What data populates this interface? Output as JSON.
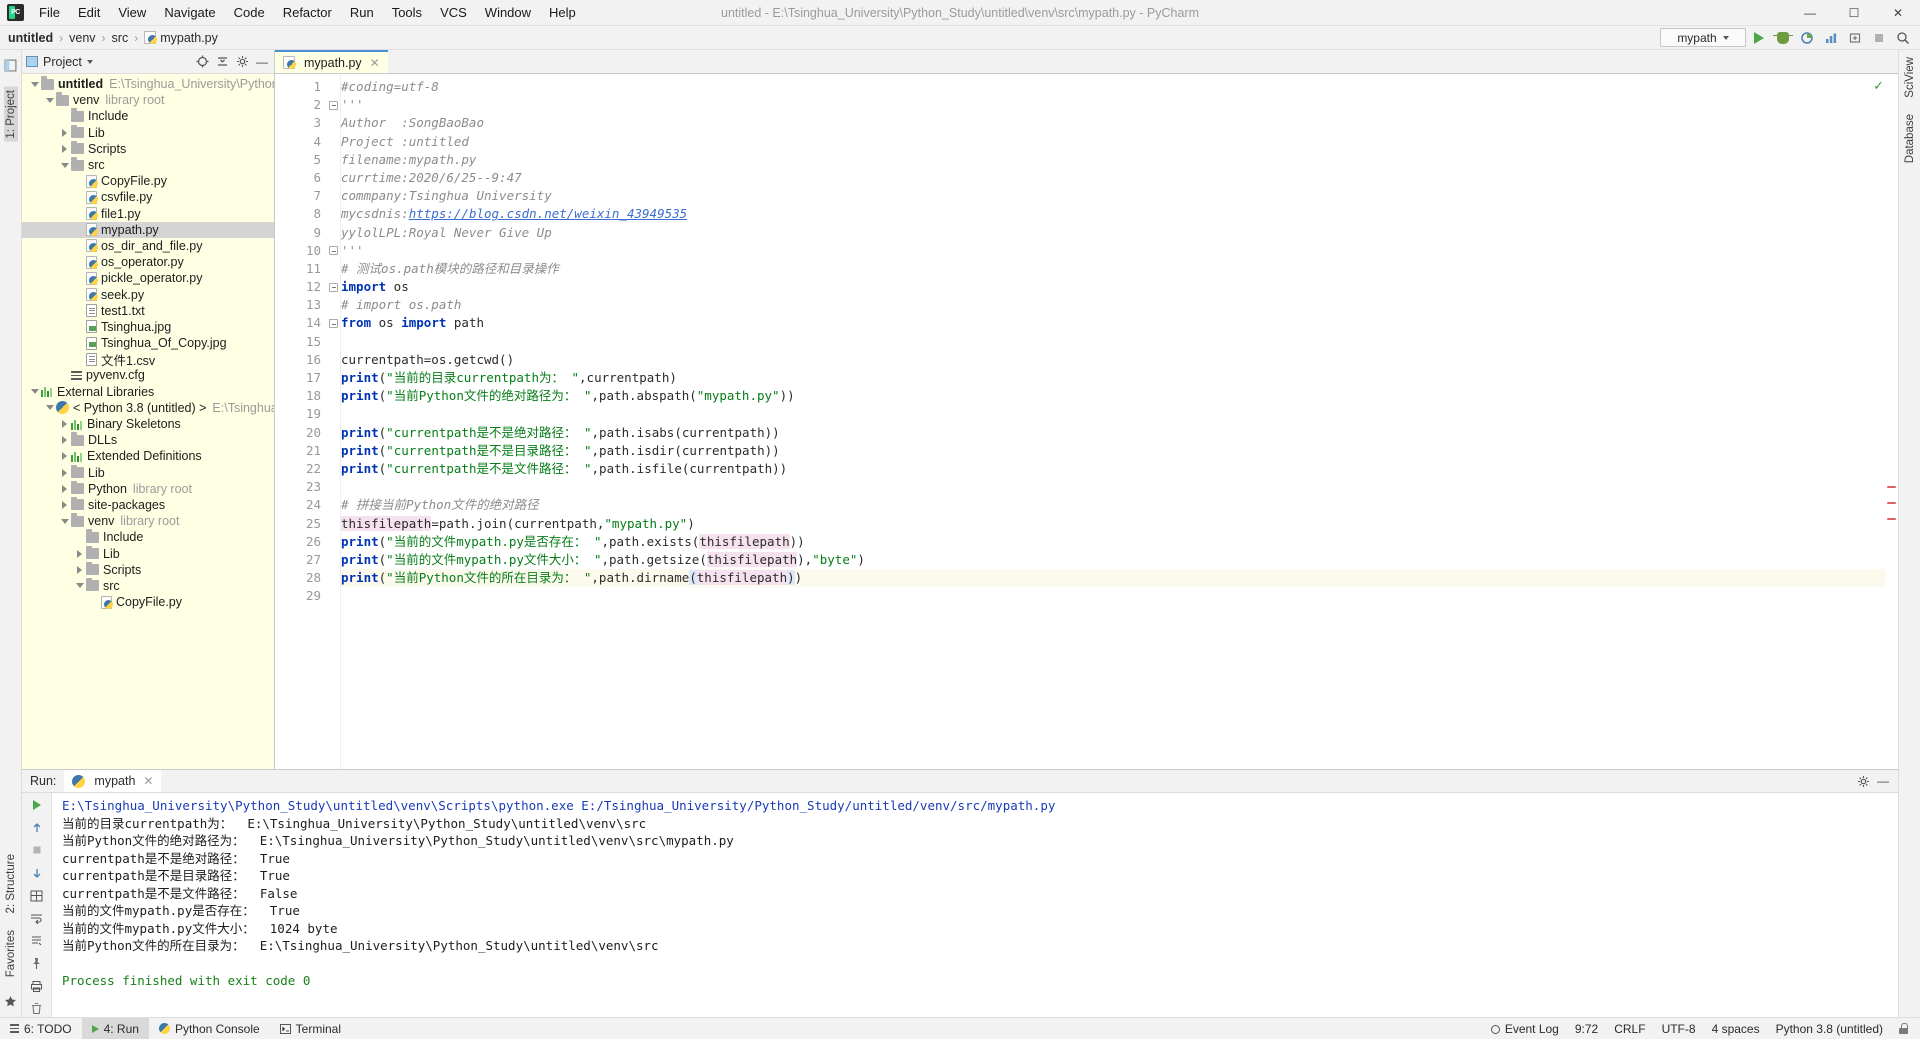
{
  "titlebar": {
    "app_badge": "PC",
    "title": "untitled - E:\\Tsinghua_University\\Python_Study\\untitled\\venv\\src\\mypath.py - PyCharm",
    "menu": [
      "File",
      "Edit",
      "View",
      "Navigate",
      "Code",
      "Refactor",
      "Run",
      "Tools",
      "VCS",
      "Window",
      "Help"
    ],
    "window_controls": {
      "minimize": "—",
      "maximize": "☐",
      "close": "✕"
    }
  },
  "navbar": {
    "crumbs": [
      "untitled",
      "venv",
      "src",
      "mypath.py"
    ],
    "separator": "›",
    "run_config": "mypath",
    "buttons": [
      "run-button",
      "debug-button",
      "coverage-button",
      "profile-button",
      "attach-button",
      "stop-button",
      "search-button"
    ]
  },
  "left_rail": {
    "top": [
      "1: Project"
    ],
    "bottom": [
      "2: Structure",
      "Favorites"
    ]
  },
  "right_rail": {
    "top": [
      "SciView",
      "Database"
    ]
  },
  "project_panel": {
    "title": "Project",
    "tree": [
      {
        "indent": 0,
        "arrow": "down",
        "icon": "folder",
        "name": "untitled",
        "bold": true,
        "sub": "E:\\Tsinghua_University\\Python_Study\\u"
      },
      {
        "indent": 1,
        "arrow": "down",
        "icon": "folder",
        "name": "venv",
        "sub": "library root"
      },
      {
        "indent": 2,
        "arrow": "none",
        "icon": "folder",
        "name": "Include",
        "sub": ""
      },
      {
        "indent": 2,
        "arrow": "right",
        "icon": "folder",
        "name": "Lib",
        "sub": ""
      },
      {
        "indent": 2,
        "arrow": "right",
        "icon": "folder",
        "name": "Scripts",
        "sub": ""
      },
      {
        "indent": 2,
        "arrow": "down",
        "icon": "folder",
        "name": "src",
        "sub": ""
      },
      {
        "indent": 3,
        "arrow": "none",
        "icon": "py",
        "name": "CopyFile.py",
        "sub": ""
      },
      {
        "indent": 3,
        "arrow": "none",
        "icon": "py",
        "name": "csvfile.py",
        "sub": ""
      },
      {
        "indent": 3,
        "arrow": "none",
        "icon": "py",
        "name": "file1.py",
        "sub": ""
      },
      {
        "indent": 3,
        "arrow": "none",
        "icon": "py",
        "name": "mypath.py",
        "sub": "",
        "selected": true
      },
      {
        "indent": 3,
        "arrow": "none",
        "icon": "py",
        "name": "os_dir_and_file.py",
        "sub": ""
      },
      {
        "indent": 3,
        "arrow": "none",
        "icon": "py",
        "name": "os_operator.py",
        "sub": ""
      },
      {
        "indent": 3,
        "arrow": "none",
        "icon": "py",
        "name": "pickle_operator.py",
        "sub": ""
      },
      {
        "indent": 3,
        "arrow": "none",
        "icon": "py",
        "name": "seek.py",
        "sub": ""
      },
      {
        "indent": 3,
        "arrow": "none",
        "icon": "txt",
        "name": "test1.txt",
        "sub": ""
      },
      {
        "indent": 3,
        "arrow": "none",
        "icon": "img",
        "name": "Tsinghua.jpg",
        "sub": ""
      },
      {
        "indent": 3,
        "arrow": "none",
        "icon": "img",
        "name": "Tsinghua_Of_Copy.jpg",
        "sub": ""
      },
      {
        "indent": 3,
        "arrow": "none",
        "icon": "txt",
        "name": "文件1.csv",
        "sub": ""
      },
      {
        "indent": 2,
        "arrow": "none",
        "icon": "cfg",
        "name": "pyvenv.cfg",
        "sub": ""
      },
      {
        "indent": 0,
        "arrow": "down",
        "icon": "lib",
        "name": "External Libraries",
        "sub": ""
      },
      {
        "indent": 1,
        "arrow": "down",
        "icon": "pyint",
        "name": "< Python 3.8 (untitled) >",
        "sub": "E:\\Tsinghua_Univers"
      },
      {
        "indent": 2,
        "arrow": "right",
        "icon": "lib",
        "name": "Binary Skeletons",
        "sub": ""
      },
      {
        "indent": 2,
        "arrow": "right",
        "icon": "folder",
        "name": "DLLs",
        "sub": ""
      },
      {
        "indent": 2,
        "arrow": "right",
        "icon": "lib",
        "name": "Extended Definitions",
        "sub": ""
      },
      {
        "indent": 2,
        "arrow": "right",
        "icon": "folder",
        "name": "Lib",
        "sub": ""
      },
      {
        "indent": 2,
        "arrow": "right",
        "icon": "folder",
        "name": "Python",
        "sub": "library root"
      },
      {
        "indent": 2,
        "arrow": "right",
        "icon": "folder",
        "name": "site-packages",
        "sub": ""
      },
      {
        "indent": 2,
        "arrow": "down",
        "icon": "folder",
        "name": "venv",
        "sub": "library root"
      },
      {
        "indent": 3,
        "arrow": "none",
        "icon": "folder",
        "name": "Include",
        "sub": ""
      },
      {
        "indent": 3,
        "arrow": "right",
        "icon": "folder",
        "name": "Lib",
        "sub": ""
      },
      {
        "indent": 3,
        "arrow": "right",
        "icon": "folder",
        "name": "Scripts",
        "sub": ""
      },
      {
        "indent": 3,
        "arrow": "down",
        "icon": "folder",
        "name": "src",
        "sub": ""
      },
      {
        "indent": 4,
        "arrow": "none",
        "icon": "py",
        "name": "CopyFile.py",
        "sub": ""
      }
    ]
  },
  "editor": {
    "tab": {
      "label": "mypath.py",
      "close": "✕"
    },
    "line_numbers": [
      1,
      2,
      3,
      4,
      5,
      6,
      7,
      8,
      9,
      10,
      11,
      12,
      13,
      14,
      15,
      16,
      17,
      18,
      19,
      20,
      21,
      22,
      23,
      24,
      25,
      26,
      27,
      28,
      29
    ],
    "lines": [
      "#coding=utf-8",
      "'''",
      "Author  :SongBaoBao",
      "Project :untitled",
      "filename:mypath.py",
      "currtime:2020/6/25--9:47",
      "commpany:Tsinghua University",
      "mycsdnis:https://blog.csdn.net/weixin_43949535",
      "yylolLPL:Royal Never Give Up",
      "'''",
      "# 测试os.path模块的路径和目录操作",
      "import os",
      "# import os.path",
      "from os import path",
      "",
      "currentpath=os.getcwd()",
      "print(\"当前的目录currentpath为： \",currentpath)",
      "print(\"当前Python文件的绝对路径为： \",path.abspath(\"mypath.py\"))",
      "",
      "print(\"currentpath是不是绝对路径： \",path.isabs(currentpath))",
      "print(\"currentpath是不是目录路径： \",path.isdir(currentpath))",
      "print(\"currentpath是不是文件路径： \",path.isfile(currentpath))",
      "",
      "# 拼接当前Python文件的绝对路径",
      "thisfilepath=path.join(currentpath,\"mypath.py\")",
      "print(\"当前的文件mypath.py是否存在： \",path.exists(thisfilepath))",
      "print(\"当前的文件mypath.py文件大小： \",path.getsize(thisfilepath),\"byte\")",
      "print(\"当前Python文件的所在目录为： \",path.dirname(thisfilepath))"
    ],
    "inspection_ok": "✓"
  },
  "run_panel": {
    "label": "Run:",
    "tab": "mypath",
    "tab_close": "✕",
    "tools": [
      "rerun-button",
      "scroll-up-button",
      "stop-button",
      "scroll-down-button",
      "print-layout-button",
      "soft-wrap-button",
      "scroll-to-end-button",
      "pin-button",
      "print-button",
      "clear-all-button"
    ],
    "output": [
      {
        "text": "E:\\Tsinghua_University\\Python_Study\\untitled\\venv\\Scripts\\python.exe E:/Tsinghua_University/Python_Study/untitled/venv/src/mypath.py",
        "style": "path"
      },
      {
        "text": "当前的目录currentpath为：  E:\\Tsinghua_University\\Python_Study\\untitled\\venv\\src",
        "style": "normal"
      },
      {
        "text": "当前Python文件的绝对路径为：  E:\\Tsinghua_University\\Python_Study\\untitled\\venv\\src\\mypath.py",
        "style": "normal"
      },
      {
        "text": "currentpath是不是绝对路径：  True",
        "style": "normal"
      },
      {
        "text": "currentpath是不是目录路径：  True",
        "style": "normal"
      },
      {
        "text": "currentpath是不是文件路径：  False",
        "style": "normal"
      },
      {
        "text": "当前的文件mypath.py是否存在：  True",
        "style": "normal"
      },
      {
        "text": "当前的文件mypath.py文件大小：  1024 byte",
        "style": "normal"
      },
      {
        "text": "当前Python文件的所在目录为：  E:\\Tsinghua_University\\Python_Study\\untitled\\venv\\src",
        "style": "normal"
      },
      {
        "text": "",
        "style": "normal"
      },
      {
        "text": "Process finished with exit code 0",
        "style": "ok"
      }
    ]
  },
  "statusbar": {
    "tabs": [
      {
        "label": "6: TODO",
        "icon": "list-icon",
        "selected": false
      },
      {
        "label": "4: Run",
        "icon": "run-icon",
        "selected": true
      },
      {
        "label": "Python Console",
        "icon": "python-icon",
        "selected": false
      },
      {
        "label": "Terminal",
        "icon": "terminal-icon",
        "selected": false
      }
    ],
    "event_log": "Event Log",
    "caret": "9:72",
    "line_sep": "CRLF",
    "encoding": "UTF-8",
    "indent": "4 spaces",
    "interpreter": "Python 3.8 (untitled)"
  }
}
